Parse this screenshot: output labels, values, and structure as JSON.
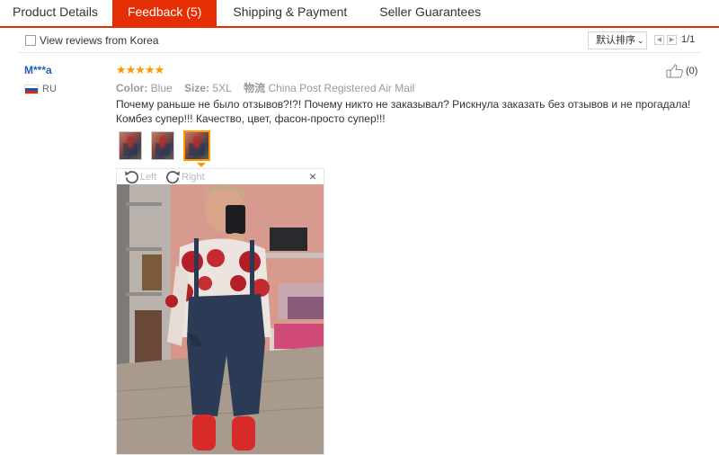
{
  "tabs": [
    {
      "label": "Product Details"
    },
    {
      "label": "Feedback (5)"
    },
    {
      "label": "Shipping & Payment"
    },
    {
      "label": "Seller Guarantees"
    }
  ],
  "filter": {
    "view_korea_label": "View reviews from Korea",
    "sort_label": "默认排序",
    "page": "1/1"
  },
  "review": {
    "user": "M***a",
    "country": "RU",
    "rating": 5,
    "stars": "★★★★★",
    "color_label": "Color:",
    "color_value": "Blue",
    "size_label": "Size:",
    "size_value": "5XL",
    "logistics_label": "物流",
    "logistics_value": "China Post Registered Air Mail",
    "text": "Почему раньше не было отзывов?!?! Почему никто не заказывал? Рискнула заказать без отзывов и не прогадала! Комбез супер!!! Качество, цвет, фасон-просто супер!!!",
    "helpful_count": "(0)"
  },
  "viewer": {
    "rotate_left": "Left",
    "rotate_right": "Right",
    "close": "×"
  },
  "colors": {
    "accent": "#e62e04",
    "user_link": "#2161b7",
    "star": "#ff9900"
  }
}
